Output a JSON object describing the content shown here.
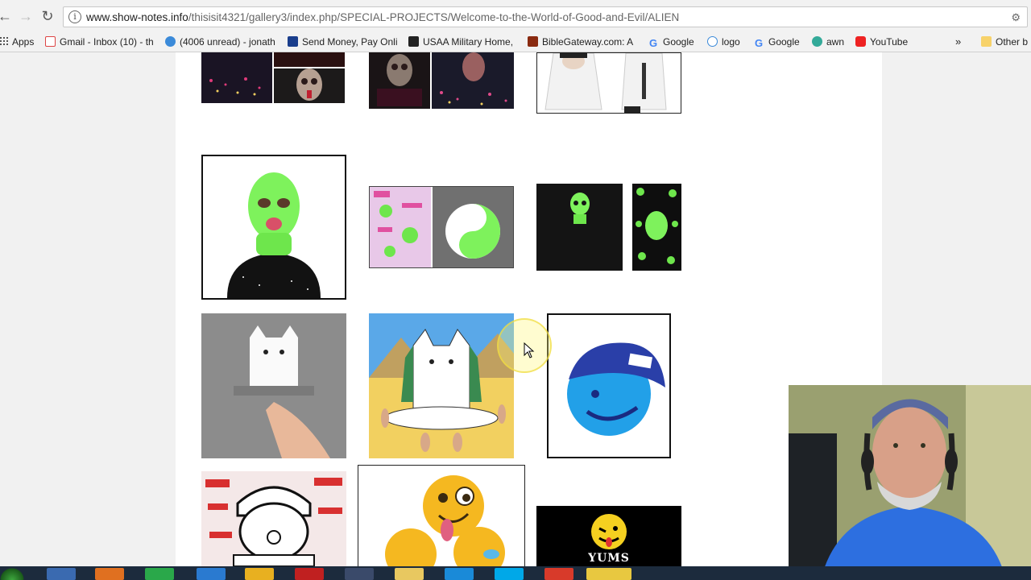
{
  "browser": {
    "url_host": "www.show-notes.info",
    "url_path": "/thisisit4321/gallery3/index.php/SPECIAL-PROJECTS/Welcome-to-the-World-of-Good-and-Evil/ALIEN"
  },
  "bookmarks": [
    {
      "label": "Apps",
      "color": "#d44"
    },
    {
      "label": "Gmail - Inbox (10) - th",
      "color": "#d44"
    },
    {
      "label": "(4006 unread) - jonath",
      "color": "#3b8ad9"
    },
    {
      "label": "Send Money, Pay Onli",
      "color": "#1a3e8c"
    },
    {
      "label": "USAA Military Home,",
      "color": "#222"
    },
    {
      "label": "BibleGateway.com: A",
      "color": "#8a2a10"
    },
    {
      "label": "Google",
      "color": "#4285f4"
    },
    {
      "label": "logo",
      "color": "#3b8ad9"
    },
    {
      "label": "Google",
      "color": "#4285f4"
    },
    {
      "label": "awn",
      "color": "#3a9"
    },
    {
      "label": "YouTube",
      "color": "#e22"
    }
  ],
  "bookmarks_more": "»",
  "bookmarks_other": "Other b",
  "gallery": [
    {
      "name": "thumb-city-skull-collage"
    },
    {
      "name": "thumb-skull-city-collage"
    },
    {
      "name": "thumb-white-sweater"
    },
    {
      "name": "thumb-green-ski-mask"
    },
    {
      "name": "thumb-alien-yin-yang"
    },
    {
      "name": "thumb-glowing-alien-shirt"
    },
    {
      "name": "thumb-cat-pocket-shirt"
    },
    {
      "name": "thumb-cat-sphinx"
    },
    {
      "name": "thumb-neff-cap-face"
    },
    {
      "name": "thumb-cartoon-character-cap"
    },
    {
      "name": "thumb-emoji-pile"
    },
    {
      "name": "thumb-yums-logo"
    }
  ],
  "yums_label": "YUMS"
}
